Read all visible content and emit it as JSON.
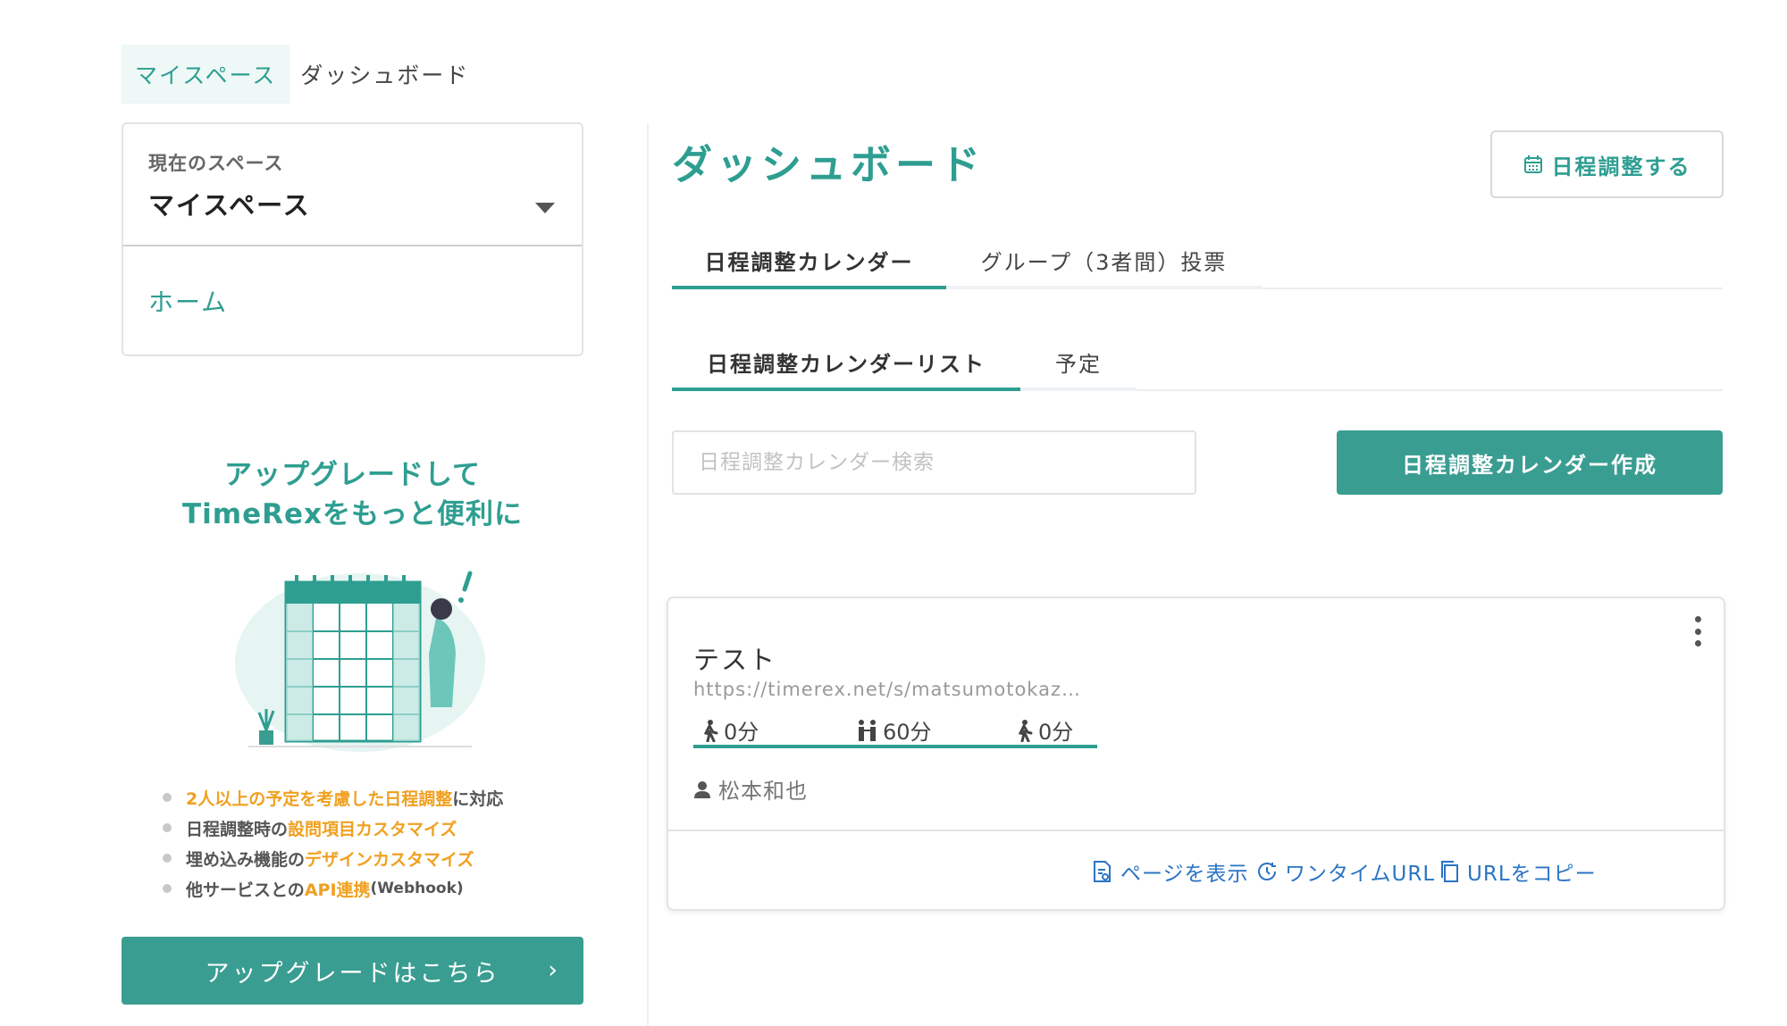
{
  "breadcrumb": {
    "active": "マイスペース",
    "current": "ダッシュボード"
  },
  "space": {
    "caption": "現在のスペース",
    "name": "マイスペース",
    "home": "ホーム"
  },
  "promo": {
    "title_line1": "アップグレードして",
    "title_line2": "TimeRexをもっと便利に",
    "features": [
      {
        "hl1": "2人以上の予定を考慮した日程調整",
        "rest1": "に対応"
      },
      {
        "pre": "日程調整時の",
        "hl": "設問項目カスタマイズ"
      },
      {
        "pre": "埋め込み機能の",
        "hl": "デザインカスタマイズ"
      },
      {
        "pre": "他サービスとの",
        "hl": "API連携",
        "post": " (Webhook)"
      }
    ],
    "button": "アップグレードはこちら",
    "button_chevron": "›"
  },
  "main": {
    "title": "ダッシュボード",
    "schedule_button": "日程調整する",
    "tabs": [
      "日程調整カレンダー",
      "グループ（3者間）投票"
    ],
    "subtabs": [
      "日程調整カレンダーリスト",
      "予定"
    ],
    "search_placeholder": "日程調整カレンダー検索",
    "create_button": "日程調整カレンダー作成"
  },
  "card": {
    "title": "テスト",
    "url": "https://timerex.net/s/matsumotokaz…",
    "before": "0分",
    "duration": "60分",
    "after": "0分",
    "owner": "松本和也",
    "actions": [
      "ページを表示",
      "ワンタイムURL",
      "URLをコピー"
    ]
  },
  "colors": {
    "accent": "#2e9e91",
    "button": "#3a9d91",
    "highlight": "#f0a020",
    "link": "#2a74c4"
  },
  "icons": [
    "calendar-icon",
    "caret-down-icon",
    "kebab-icon",
    "walk-icon",
    "people-icon",
    "person-icon",
    "document-icon",
    "clock-icon",
    "copy-icon"
  ]
}
